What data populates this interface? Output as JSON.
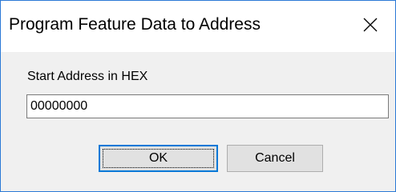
{
  "window": {
    "title": "Program Feature Data to Address",
    "close_icon": "close-icon",
    "accent_color": "#2b79d6"
  },
  "form": {
    "label": "Start Address in HEX",
    "address_value": "00000000"
  },
  "buttons": {
    "ok_label": "OK",
    "cancel_label": "Cancel",
    "default_button_color": "#0078d7"
  }
}
